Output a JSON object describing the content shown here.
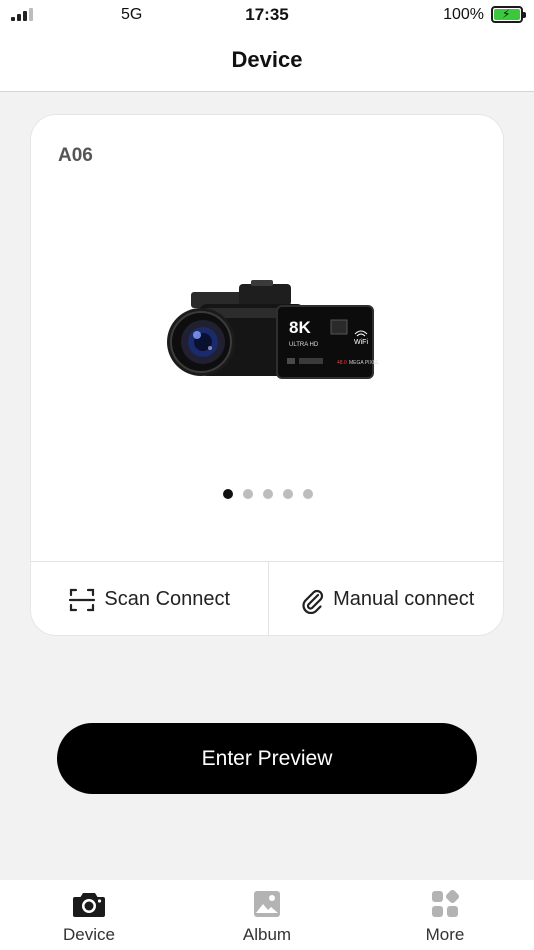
{
  "status_bar": {
    "network": "5G",
    "time": "17:35",
    "battery": "100%"
  },
  "nav": {
    "title": "Device"
  },
  "device_card": {
    "model": "A06",
    "carousel": {
      "count": 5,
      "active_index": 0
    },
    "scan_connect": {
      "label": "Scan Connect",
      "icon": "scan-icon"
    },
    "manual_connect": {
      "label": "Manual connect",
      "icon": "paperclip-icon"
    }
  },
  "preview_button": {
    "label": "Enter Preview"
  },
  "tabs": [
    {
      "label": "Device",
      "icon": "camera-icon",
      "active": true
    },
    {
      "label": "Album",
      "icon": "image-icon",
      "active": false
    },
    {
      "label": "More",
      "icon": "grid-icon",
      "active": false
    }
  ],
  "colors": {
    "accent": "#000000",
    "active_tab": "#1a1a1a",
    "inactive_tab": "#b3b3b3",
    "battery_fill": "#3cc83c"
  }
}
